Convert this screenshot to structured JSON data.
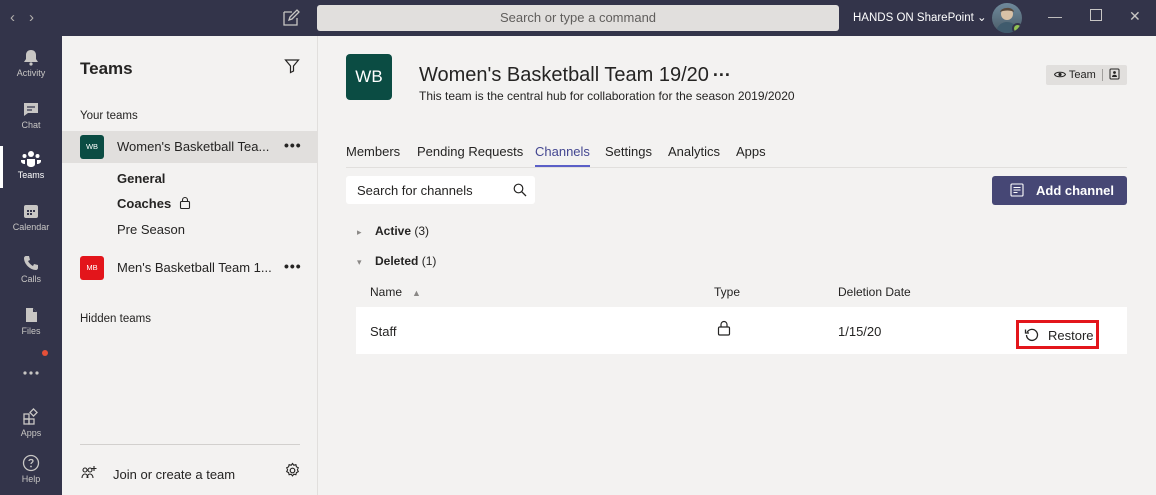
{
  "titlebar": {
    "search_placeholder": "Search or type a command",
    "org_name": "HANDS ON SharePoint",
    "org_chevron": "⌄",
    "back_glyph": "‹",
    "forward_glyph": "›"
  },
  "rail": [
    {
      "label": "Activity",
      "icon": "bell-icon"
    },
    {
      "label": "Chat",
      "icon": "chat-icon"
    },
    {
      "label": "Teams",
      "icon": "teams-icon",
      "active": true
    },
    {
      "label": "Calendar",
      "icon": "calendar-icon"
    },
    {
      "label": "Calls",
      "icon": "phone-icon"
    },
    {
      "label": "Files",
      "icon": "file-icon"
    },
    {
      "label": "",
      "icon": "more-apps-icon"
    },
    {
      "label": "Apps",
      "icon": "apps-icon"
    },
    {
      "label": "Help",
      "icon": "help-icon"
    }
  ],
  "panel": {
    "title": "Teams",
    "your_teams": "Your teams",
    "teams": [
      {
        "initials": "WB",
        "name": "Women's Basketball Tea...",
        "more": "•••",
        "color": "#0b4c43"
      },
      {
        "initials": "MB",
        "name": "Men's Basketball Team 1...",
        "more": "•••",
        "color": "#e3151b"
      }
    ],
    "channels": [
      {
        "name": "General",
        "bold": true
      },
      {
        "name": "Coaches",
        "bold": true,
        "private": true
      },
      {
        "name": "Pre Season",
        "bold": false
      }
    ],
    "hidden_teams": "Hidden teams",
    "join_label": "Join or create a team"
  },
  "team": {
    "logo": "WB",
    "title": "Women's Basketball Team 19/20",
    "title_more": "···",
    "description": "This team is the central hub for collaboration for the season 2019/2020",
    "badge_label": "Team",
    "tabs": [
      "Members",
      "Pending Requests",
      "Channels",
      "Settings",
      "Analytics",
      "Apps"
    ],
    "active_tab": "Channels"
  },
  "channels_view": {
    "search_placeholder": "Search for channels",
    "add_channel": "Add channel",
    "groups": [
      {
        "label": "Active",
        "count": "(3)",
        "expanded": false
      },
      {
        "label": "Deleted",
        "count": "(1)",
        "expanded": true
      }
    ],
    "columns": [
      "Name",
      "Type",
      "Deletion Date"
    ],
    "rows": [
      {
        "name": "Staff",
        "type": "lock-icon",
        "deletion_date": "1/15/20",
        "action": "Restore"
      }
    ]
  },
  "colors": {
    "rail_bg": "#33344a",
    "accent": "#464775",
    "tab_underline": "#5b5fc7",
    "highlight_box": "#e3151b"
  }
}
